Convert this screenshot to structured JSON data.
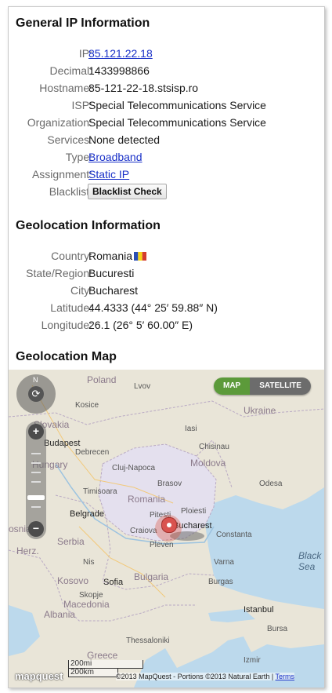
{
  "general": {
    "title": "General IP Information",
    "rows": [
      {
        "label": "IP:",
        "value": "85.121.22.18",
        "link": true
      },
      {
        "label": "Decimal:",
        "value": "1433998866"
      },
      {
        "label": "Hostname:",
        "value": "85-121-22-18.stsisp.ro"
      },
      {
        "label": "ISP:",
        "value": "Special Telecommunications Service"
      },
      {
        "label": "Organization:",
        "value": "Special Telecommunications Service"
      },
      {
        "label": "Services:",
        "value": "None detected"
      },
      {
        "label": "Type:",
        "value": "Broadband",
        "link": true
      },
      {
        "label": "Assignment:",
        "value": "Static IP",
        "link": true
      },
      {
        "label": "Blacklist:",
        "button": "Blacklist Check"
      }
    ]
  },
  "geo": {
    "title": "Geolocation Information",
    "rows": [
      {
        "label": "Country:",
        "value": "Romania"
      },
      {
        "label": "State/Region:",
        "value": "Bucuresti"
      },
      {
        "label": "City:",
        "value": "Bucharest"
      },
      {
        "label": "Latitude:",
        "value": "44.4333  (44° 25′ 59.88″ N)"
      },
      {
        "label": "Longitude:",
        "value": "26.1  (26° 5′ 60.00″ E)"
      }
    ]
  },
  "map": {
    "title": "Geolocation Map",
    "toggle_map": "MAP",
    "toggle_satellite": "SATELLITE",
    "compass_n": "N",
    "zoom_in": "+",
    "zoom_out": "−",
    "scale_mi": "200mi",
    "scale_km": "200km",
    "brand": "mapquest",
    "copyright": "©2013 MapQuest  -  Portions ©2013 Natural Earth | ",
    "terms": "Terms",
    "labels": {
      "lvov": "Lvov",
      "poland": "Poland",
      "slovakia": "Slovakia",
      "ukraine": "Ukraine",
      "budapest": "Budapest",
      "hungary": "Hungary",
      "moldova": "Moldova",
      "romania": "Romania",
      "belgrade": "Belgrade",
      "serbia": "Serbia",
      "bucharest": "Bucharest",
      "bulgaria": "Bulgaria",
      "black_sea": "Black\nSea",
      "kosovo": "Kosovo",
      "macedonia": "Macedonia",
      "albania": "Albania",
      "greece": "Greece",
      "istanbul": "Istanbul",
      "sofia": "Sofia",
      "constanta": "Constanta",
      "odesa": "Odesa",
      "chisinau": "Chisinau",
      "cluj": "Cluj-Napoca",
      "timisoara": "Timisoara",
      "craiova": "Craiova",
      "pitesti": "Pitesti",
      "varna": "Varna",
      "burgas": "Burgas",
      "ploiesti": "Ploiesti",
      "thessaloniki": "Thessaloniki",
      "debrecen": "Debrecen",
      "iasi": "Iasi",
      "brasov": "Brasov",
      "nis": "Nis",
      "pleven": "Pleven",
      "bursa": "Bursa",
      "skopje": "Skopje",
      "izmir": "Izmir",
      "kosice": "Kosice",
      "herz": "Herz.",
      "bosnia": "osnia"
    }
  }
}
